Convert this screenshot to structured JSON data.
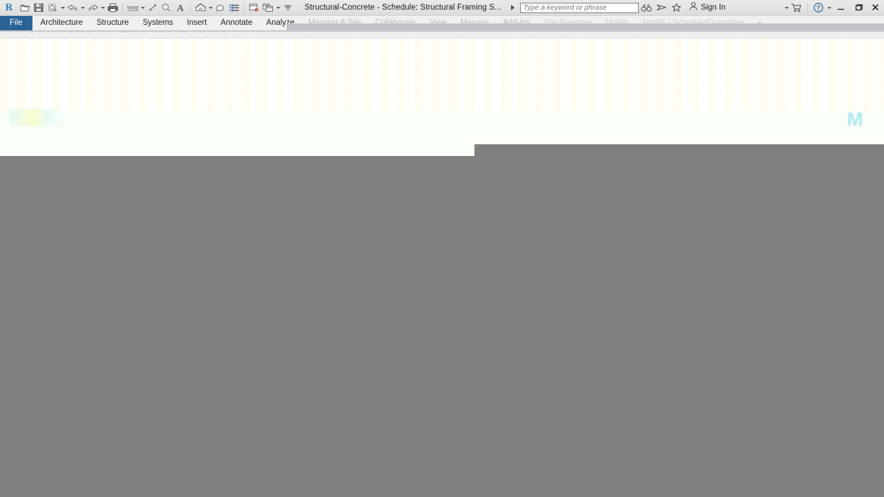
{
  "window": {
    "app_logo": "revit-r-logo",
    "title": "Structural-Concrete - Schedule: Structural Framing S...",
    "minimize_label": "–",
    "restore_label": "❐",
    "close_label": "✕"
  },
  "quick_access_toolbar": {
    "items": [
      {
        "name": "open-file",
        "icon": "open-folder-icon",
        "has_caret": false
      },
      {
        "name": "save",
        "icon": "floppy-disk-icon",
        "has_caret": false
      },
      {
        "name": "save-as",
        "icon": "save-as-cloud-icon",
        "has_caret": true
      },
      {
        "name": "undo",
        "icon": "undo-arrow-icon",
        "has_caret": true
      },
      {
        "name": "redo",
        "icon": "redo-arrow-icon",
        "has_caret": true
      },
      {
        "name": "print",
        "icon": "printer-icon",
        "has_caret": false
      },
      {
        "name": "measure",
        "icon": "measure-ruler-icon",
        "has_caret": true
      },
      {
        "name": "aligned-dimension",
        "icon": "aligned-dimension-icon",
        "has_caret": false
      },
      {
        "name": "tag-by-category",
        "icon": "tag-icon",
        "has_caret": false
      },
      {
        "name": "text-note",
        "icon": "text-A-icon",
        "has_caret": false
      },
      {
        "name": "default-3d-view",
        "icon": "house-3d-icon",
        "has_caret": true
      },
      {
        "name": "section",
        "icon": "section-icon",
        "has_caret": false
      },
      {
        "name": "thin-lines",
        "icon": "thin-lines-icon",
        "has_caret": false
      },
      {
        "name": "close-hidden-windows",
        "icon": "close-window-icon",
        "has_caret": false
      },
      {
        "name": "switch-windows",
        "icon": "switch-windows-icon",
        "has_caret": true
      },
      {
        "name": "customize-qat",
        "icon": "qat-dropdown-icon",
        "has_caret": false
      }
    ]
  },
  "search": {
    "placeholder": "Type a keyword or phrase",
    "value": ""
  },
  "title_right_icons": [
    {
      "name": "search-spyglass",
      "icon": "binoculars-icon"
    },
    {
      "name": "autodesk-a360",
      "icon": "a360-icon"
    },
    {
      "name": "favorites",
      "icon": "star-icon"
    }
  ],
  "account": {
    "sign_in_label": "Sign In",
    "avatar_icon": "person-icon",
    "sign_in_caret": true,
    "shop_icon": "shopping-cart-icon",
    "shop_caret": true,
    "help_icon": "question-circle-icon",
    "help_caret": true
  },
  "ribbon_tabs": [
    {
      "label": "File",
      "state": "active-file"
    },
    {
      "label": "Architecture",
      "state": "normal"
    },
    {
      "label": "Structure",
      "state": "normal"
    },
    {
      "label": "Systems",
      "state": "normal"
    },
    {
      "label": "Insert",
      "state": "normal"
    },
    {
      "label": "Annotate",
      "state": "normal"
    },
    {
      "label": "Analyze",
      "state": "normal"
    },
    {
      "label": "Massing & Site",
      "state": "faded"
    },
    {
      "label": "Collaborate",
      "state": "faded"
    },
    {
      "label": "View",
      "state": "faded"
    },
    {
      "label": "Manage",
      "state": "faded"
    },
    {
      "label": "Add-Ins",
      "state": "faded"
    },
    {
      "label": "Site Designer",
      "state": "faded2"
    },
    {
      "label": "Modify",
      "state": "faded2"
    },
    {
      "label": "Modify | Schedule/Quantities",
      "state": "faded2"
    },
    {
      "label": "▾",
      "state": "faded2"
    }
  ],
  "watermark": {
    "text": "WWW.MY-SITE.COM"
  },
  "viewport": {
    "navcube_glyph": "M",
    "content": ""
  },
  "colors": {
    "accent_blue": "#2a6496",
    "titlebar_bg": "#e4e4e4",
    "tabbar_bg": "#f0f0f0",
    "viewport_bg": "#fdfffa",
    "dead_area_gray": "#808080",
    "logo_blue": "#2b7cb8"
  }
}
